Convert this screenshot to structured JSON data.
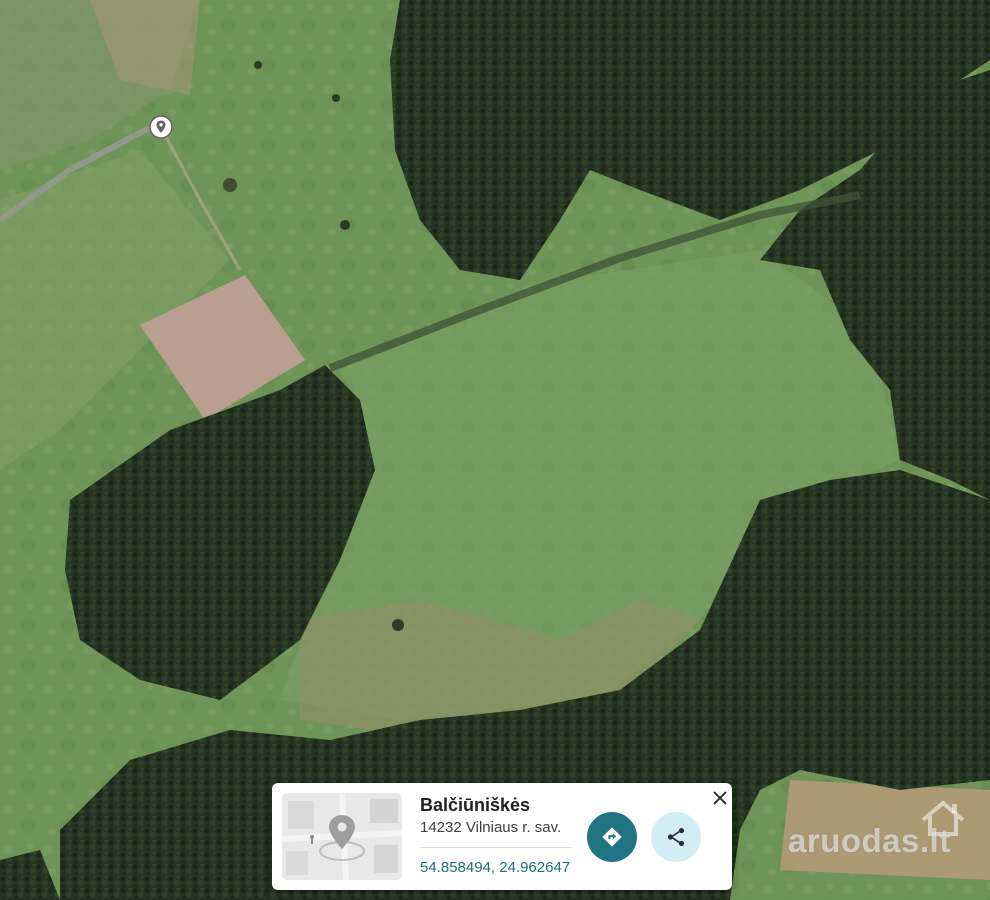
{
  "map": {
    "view": "satellite",
    "pin_icon": "location-pin-icon"
  },
  "place_card": {
    "name": "Balčiūniškės",
    "address": "14232 Vilniaus r. sav.",
    "coordinates": "54.858494, 24.962647",
    "thumbnail_icon": "map-pin-illustration",
    "directions_icon": "directions-arrow-icon",
    "share_icon": "share-icon",
    "close_icon": "close-icon"
  },
  "watermark": {
    "text": "aruodas.lt",
    "icon": "house-outline-icon"
  },
  "colors": {
    "directions_button": "#217482",
    "share_button": "#d2eef4",
    "coordinates_text": "#1a6f7d",
    "forest": "#22321f",
    "meadow": "#6e9356",
    "bare_field": "#b89b8a"
  }
}
